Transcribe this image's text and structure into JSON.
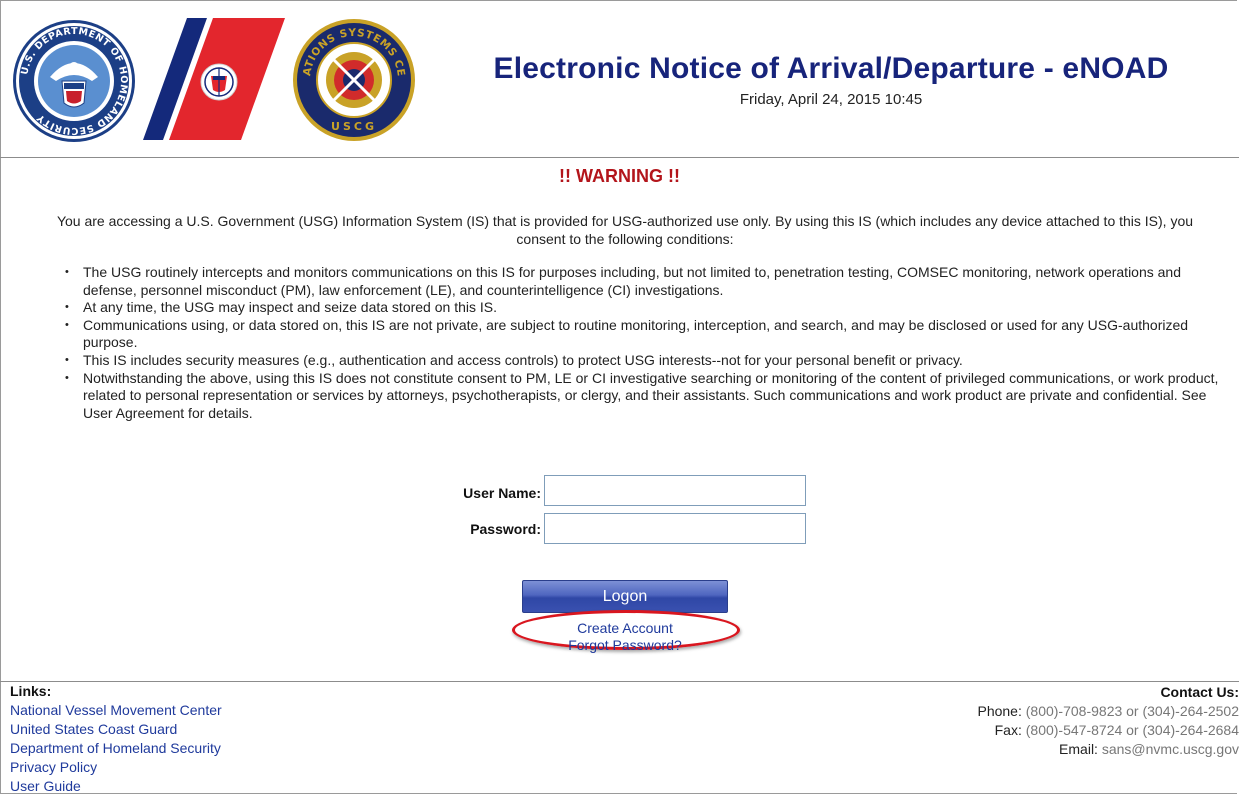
{
  "header": {
    "title": "Electronic Notice of Arrival/Departure - eNOAD",
    "datetime": "Friday, April 24, 2015 10:45",
    "dhs_seal_text": "U.S. DEPARTMENT OF HOMELAND SECURITY",
    "osc_seal_top": "OPERATIONS SYSTEMS CENTER",
    "osc_seal_bottom": "USCG",
    "colors": {
      "title": "#17247b",
      "uscg_red": "#e3262d",
      "uscg_blue": "#14297b"
    }
  },
  "warning": {
    "title": "!! WARNING !!",
    "intro": "You are accessing a U.S. Government (USG) Information System (IS) that is provided for USG-authorized use only. By using this IS (which includes any device attached to this IS), you consent to the following conditions:",
    "bullets": [
      "The USG routinely intercepts and monitors communications on this IS for purposes including, but not limited to, penetration testing, COMSEC monitoring, network operations and defense, personnel misconduct (PM), law enforcement (LE), and counterintelligence (CI) investigations.",
      "At any time, the USG may inspect and seize data stored on this IS.",
      "Communications using, or data stored on, this IS are not private, are subject to routine monitoring, interception, and search, and may be disclosed or used for any USG-authorized purpose.",
      "This IS includes security measures (e.g., authentication and access controls) to protect USG interests--not for your personal benefit or privacy.",
      "Notwithstanding the above, using this IS does not constitute consent to PM, LE or CI investigative searching or monitoring of the content of privileged communications, or work product, related to personal representation or services by attorneys, psychotherapists, or clergy, and their assistants. Such communications and work product are private and confidential. See User Agreement for details."
    ],
    "color": "#b3151b"
  },
  "login": {
    "username_label": "User Name:",
    "username_value": "",
    "password_label": "Password:",
    "password_value": "",
    "logon_label": "Logon",
    "create_account": "Create Account",
    "forgot_password": "Forgot Password?",
    "highlight_color": "#d9161f"
  },
  "footer": {
    "links_title": "Links:",
    "links": [
      "National Vessel Movement Center",
      "United States Coast Guard",
      "Department of Homeland Security",
      "Privacy Policy",
      "User Guide"
    ],
    "contact_title": "Contact Us:",
    "phone_label": "Phone:",
    "phone_value": "(800)-708-9823 or (304)-264-2502",
    "fax_label": "Fax:",
    "fax_value": "(800)-547-8724 or (304)-264-2684",
    "email_label": "Email:",
    "email_value": "sans@nvmc.uscg.gov"
  }
}
